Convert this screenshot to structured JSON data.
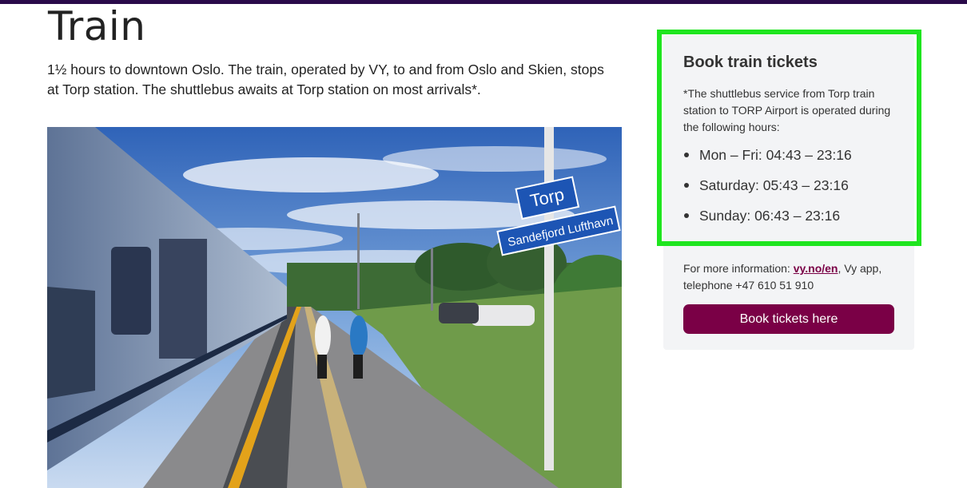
{
  "page": {
    "title": "Train",
    "intro": "1½ hours to downtown Oslo. The train, operated by VY, to and from Oslo and Skien, stops at Torp station. The shuttlebus awaits at Torp station on most arrivals*."
  },
  "hero_image": {
    "sign_top": "Torp",
    "sign_bottom": "Sandefjord Lufthavn"
  },
  "sidebar": {
    "title": "Book train tickets",
    "note": "*The shuttlebus service from Torp train station to TORP Airport is operated during the following hours:",
    "hours": [
      "Mon – Fri: 04:43 – 23:16",
      "Saturday: 05:43 – 23:16",
      "Sunday: 06:43 – 23:16"
    ],
    "more_info_prefix": "For more information: ",
    "more_info_link": "vy.no/en",
    "more_info_suffix": ", Vy app, telephone +47 610 51 910",
    "book_button": "Book tickets here"
  },
  "colors": {
    "accent": "#7a0046",
    "highlight": "#1fe51f",
    "topbar": "#2a0a4a"
  }
}
